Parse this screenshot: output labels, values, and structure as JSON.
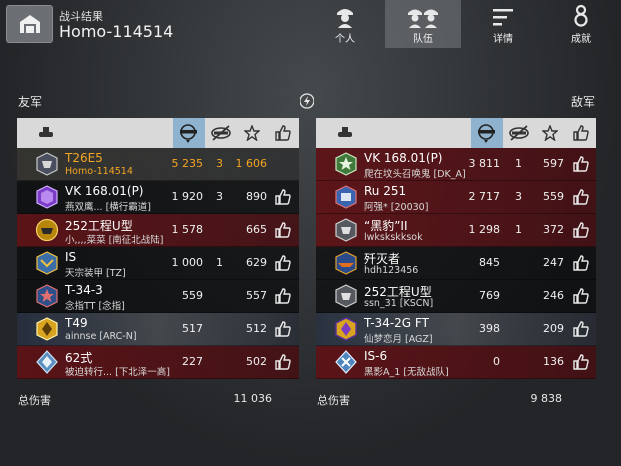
{
  "header": {
    "subtitle": "战斗结果",
    "title": "Homo-114514",
    "tabs": [
      {
        "label": "个人",
        "icon": "soldier-icon",
        "active": false
      },
      {
        "label": "队伍",
        "icon": "team-icon",
        "active": true
      },
      {
        "label": "详情",
        "icon": "list-icon",
        "active": false
      },
      {
        "label": "成就",
        "icon": "medal-icon",
        "active": false
      }
    ]
  },
  "allies": {
    "label": "友军",
    "rows": [
      {
        "tank": "T26E5",
        "player": "Homo-114514",
        "damage": "5 235",
        "kills": "3",
        "xp": "1 606",
        "me": true,
        "like": false
      },
      {
        "tank": "VK 168.01(P)",
        "player": "燕双鹰... [横行霸道]",
        "damage": "1 920",
        "kills": "3",
        "xp": "890",
        "like": true
      },
      {
        "tank": "252工程U型",
        "player": "小,,,,菜菜 [南征北战陆]",
        "damage": "1 578",
        "kills": "",
        "xp": "665",
        "like": true
      },
      {
        "tank": "IS",
        "player": "天宗装甲 [TZ]",
        "damage": "1 000",
        "kills": "1",
        "xp": "629",
        "like": true
      },
      {
        "tank": "T-34-3",
        "player": "念指TT [念指]",
        "damage": "559",
        "kills": "",
        "xp": "557",
        "like": true
      },
      {
        "tank": "T49",
        "player": "ainnse [ARC-N]",
        "damage": "517",
        "kills": "",
        "xp": "512",
        "like": true
      },
      {
        "tank": "62式",
        "player": "被迫转行... [下北泽一高]",
        "damage": "227",
        "kills": "",
        "xp": "502",
        "like": true
      }
    ],
    "total_label": "总伤害",
    "total": "11 036"
  },
  "enemies": {
    "label": "敌军",
    "rows": [
      {
        "tank": "VK 168.01(P)",
        "player": "爬在坟头召唤鬼 [DK_A]",
        "damage": "3 811",
        "kills": "1",
        "xp": "597",
        "like": true
      },
      {
        "tank": "Ru 251",
        "player": "阿强* [20030]",
        "damage": "2 717",
        "kills": "3",
        "xp": "559",
        "like": true
      },
      {
        "tank": "“黑豹”II",
        "player": "lwkskskksok",
        "damage": "1 298",
        "kills": "1",
        "xp": "372",
        "like": true
      },
      {
        "tank": "歼灭者",
        "player": "hdh123456",
        "damage": "845",
        "kills": "",
        "xp": "247",
        "like": true
      },
      {
        "tank": "252工程U型",
        "player": "ssn_31 [KSCN]",
        "damage": "769",
        "kills": "",
        "xp": "246",
        "like": true
      },
      {
        "tank": "T-34-2G FT",
        "player": "仙梦恋月 [AGZ]",
        "damage": "398",
        "kills": "",
        "xp": "209",
        "like": true
      },
      {
        "tank": "IS-6",
        "player": "黑影A_1 [无敌战队]",
        "damage": "0",
        "kills": "",
        "xp": "136",
        "like": true
      }
    ],
    "total_label": "总伤害",
    "total": "9 838"
  },
  "colors": {
    "highlight": "#f5a623",
    "header_bg": "#d9d9d9",
    "sort_column": "#8fb3cf",
    "destroyed_row": "#5f1216"
  }
}
